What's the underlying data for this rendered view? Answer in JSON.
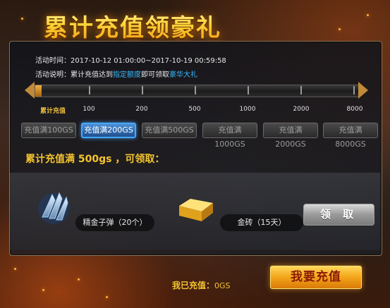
{
  "title": "累计充值领豪礼",
  "event": {
    "time_label": "活动时间：",
    "time_value": "2017-10-12 01:00:00~2017-10-19 00:59:58",
    "desc_label": "活动说明：",
    "desc_part1": "累计充值达到",
    "desc_hl1": "指定额度",
    "desc_part2": "即可领取",
    "desc_hl2": "豪华大礼"
  },
  "progress": {
    "fill_fraction": 0.02,
    "start_label": "累计充值",
    "marks": [
      "100",
      "200",
      "500",
      "1000",
      "2000",
      "8000"
    ]
  },
  "tabs": [
    {
      "label": "充值满100GS",
      "active": false
    },
    {
      "label": "充值满200GS",
      "active": true
    },
    {
      "label": "充值满500GS",
      "active": false
    },
    {
      "label": "充值满1000GS",
      "active": false
    },
    {
      "label": "充值满2000GS",
      "active": false
    },
    {
      "label": "充值满8000GS",
      "active": false
    }
  ],
  "reach": {
    "prefix": "累计充值满",
    "amount": "500gs",
    "suffix": "，可领取："
  },
  "rewards": [
    {
      "icon": "bullet-emblem-icon",
      "label": "精金子弹（20个）"
    },
    {
      "icon": "gold-brick-icon",
      "label": "金砖（15天）"
    }
  ],
  "claim_label": "领 取",
  "recharged": {
    "label": "我已充值：",
    "value": "0GS"
  },
  "recharge_button": "我要充值",
  "colors": {
    "accent_gold": "#f4c430",
    "link_blue": "#38b8ff",
    "active_tab_blue": "#46a8ff"
  }
}
